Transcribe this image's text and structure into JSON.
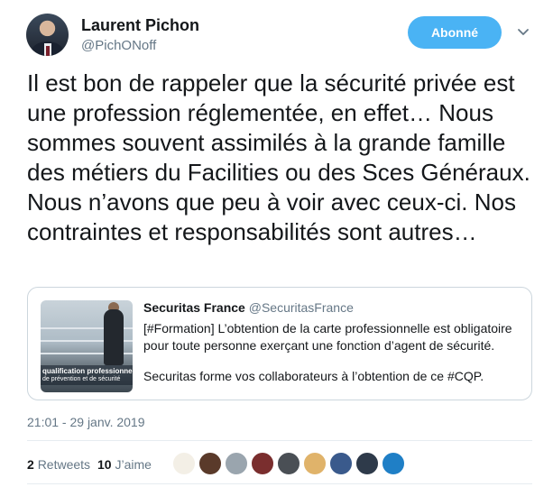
{
  "author": {
    "display_name": "Laurent Pichon",
    "handle": "@PichONoff"
  },
  "follow_button": {
    "label": "Abonné"
  },
  "tweet": {
    "text": "Il est bon de rappeler que la sécurité privée est une profession réglementée, en effet… Nous sommes souvent assimilés à la grande famille des métiers du Facilities ou des Sces Généraux. Nous n’avons que peu à voir avec ceux-ci. Nos contraintes et responsabilités sont autres…",
    "timestamp": "21:01 - 29 janv. 2019"
  },
  "quoted_tweet": {
    "author_name": "Securitas France",
    "author_handle": "@SecuritasFrance",
    "lines": [
      "[#Formation] L’obtention de la carte professionnelle est obligatoire",
      "pour toute personne exerçant une fonction d’agent de sécurité.",
      "Securitas forme vos collaborateurs à l’obtention de ce #CQP."
    ],
    "media_caption_line1": "qualification professionnelle",
    "media_caption_line2": "de prévention et de sécurité"
  },
  "stats": {
    "retweets_count": "2",
    "retweets_label": "Retweets",
    "likes_count": "10",
    "likes_label": "J’aime"
  },
  "likers": [
    {
      "icon": "avatar-logo",
      "color": "#f3efe6"
    },
    {
      "icon": "avatar-photo",
      "color": "#5a3a2a"
    },
    {
      "icon": "avatar-default",
      "color": "#9aa5ae"
    },
    {
      "icon": "avatar-photo",
      "color": "#7a2e2e"
    },
    {
      "icon": "avatar-photo",
      "color": "#4a4f55"
    },
    {
      "icon": "avatar-photo",
      "color": "#e0b36a"
    },
    {
      "icon": "avatar-photo",
      "color": "#3a5a8c"
    },
    {
      "icon": "avatar-photo",
      "color": "#2e3a4a"
    },
    {
      "icon": "avatar-photo",
      "color": "#1f7fc6"
    }
  ],
  "colors": {
    "accent": "#4ab3f4",
    "secondary_text": "#657786",
    "border": "#ccd6dd"
  }
}
